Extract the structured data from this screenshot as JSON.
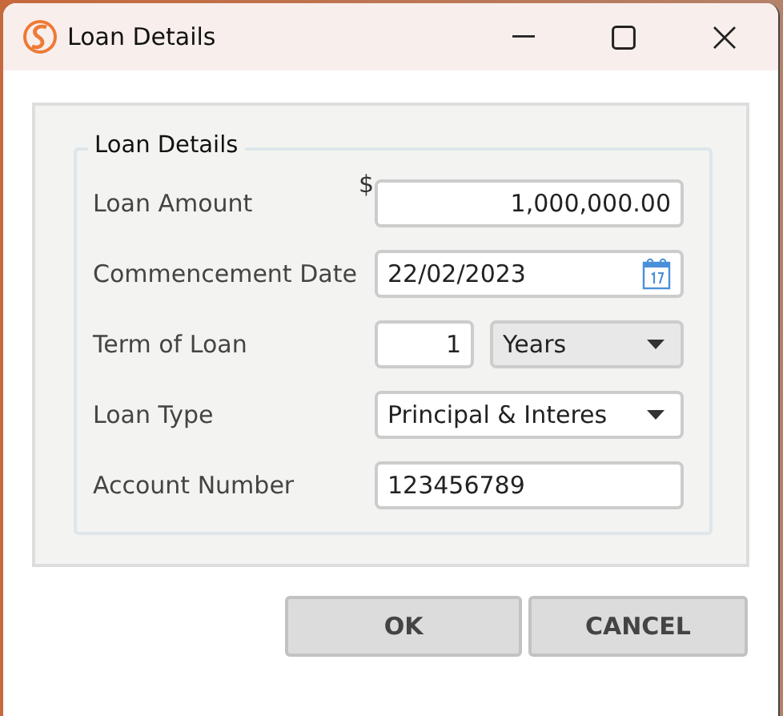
{
  "window": {
    "title": "Loan Details"
  },
  "group": {
    "title": "Loan Details"
  },
  "fields": [
    {
      "kind": "currency",
      "label": "Loan Amount",
      "prefix": "$",
      "value": "1,000,000.00"
    },
    {
      "kind": "date",
      "label": "Commencement Date",
      "value": "22/02/2023"
    },
    {
      "kind": "term",
      "label": "Term of Loan",
      "value": "1",
      "unit": "Years"
    },
    {
      "kind": "select",
      "label": "Loan Type",
      "value": "Principal & Interes"
    },
    {
      "kind": "text",
      "label": "Account Number",
      "value": "123456789"
    }
  ],
  "buttons": [
    "OK",
    "CANCEL"
  ]
}
